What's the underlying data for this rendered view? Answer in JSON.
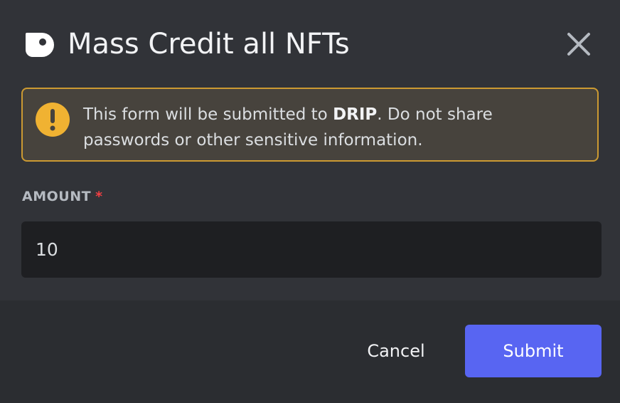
{
  "modal": {
    "app_icon": "drip-bot-icon",
    "title": "Mass Credit all NFTs",
    "close_icon": "close-icon"
  },
  "warning": {
    "icon": "exclamation-circle-icon",
    "text_before": "This form will be submitted to ",
    "app_name": "DRIP",
    "text_after": ". Do not share passwords or other sensitive information.",
    "border_color": "#cc9a32",
    "icon_color": "#f0b232"
  },
  "form": {
    "amount": {
      "label": "AMOUNT",
      "required_marker": "*",
      "value": "10"
    }
  },
  "footer": {
    "cancel_label": "Cancel",
    "submit_label": "Submit",
    "submit_color": "#5865f2"
  }
}
